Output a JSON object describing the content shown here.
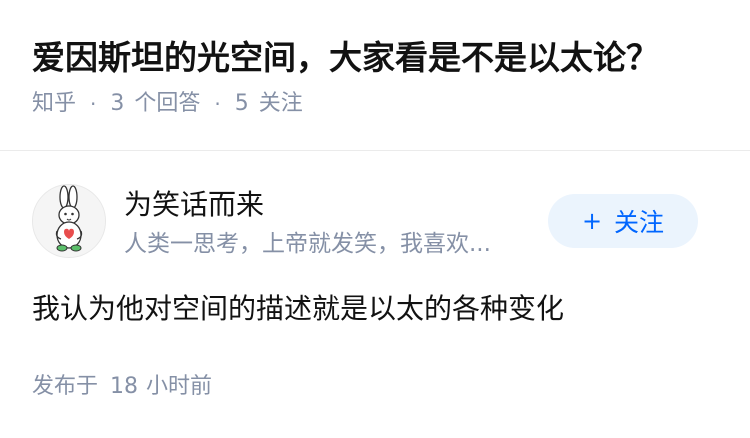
{
  "question": {
    "title": "爱因斯坦的光空间，大家看是不是以太论？",
    "source": "知乎",
    "separator": "·",
    "answers_count": "3",
    "answers_label": "个回答",
    "followers_count": "5",
    "followers_label": "关注"
  },
  "answer": {
    "author": {
      "name": "为笑话而来",
      "bio": "人类一思考，上帝就发笑，我喜欢...",
      "avatar_icon": "rabbit-avatar-icon",
      "follow_icon": "plus-icon",
      "follow_label": "关注"
    },
    "content": "我认为他对空间的描述就是以太的各种变化",
    "published_prefix": "发布于",
    "published_num": "18",
    "published_suffix": "小时前"
  },
  "colors": {
    "accent": "#0066ff",
    "follow_bg": "#ebf4fd",
    "meta": "#8590a6",
    "text": "#121212",
    "divider": "#ebebeb"
  }
}
